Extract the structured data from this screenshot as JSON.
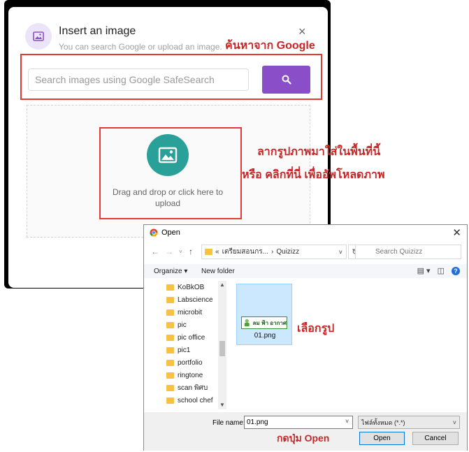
{
  "insert_dialog": {
    "title": "Insert an image",
    "subtitle": "You can search Google or upload an image.",
    "close_glyph": "×",
    "search_placeholder": "Search images using Google SafeSearch",
    "search_value": "",
    "drop_text": "Drag and drop or click here to upload",
    "accent_color": "#8a4fc8",
    "upload_color": "#2aa198"
  },
  "annotations": {
    "google_search": "ค้นหาจาก Google",
    "drag_drop_line1": "ลากรูปภาพมาใส่ในพื้นที่นี้",
    "drag_drop_line2": "หรือ คลิกที่นี่ เพื่ออัพโหลดภาพ",
    "choose_image": "เลือกรูป",
    "press_open": "กดปุ่ม Open",
    "color": "#c62828"
  },
  "open_dialog": {
    "title": "Open",
    "close_glyph": "✕",
    "address_prefix": "«",
    "address_parent": "เตรียมสอนกร...",
    "address_sep": "›",
    "address_current": "Quizizz",
    "search_placeholder": "Search Quizizz",
    "organize_label": "Organize ▾",
    "new_folder_label": "New folder",
    "folders": [
      "KoBkOB",
      "Labscience",
      "microbit",
      "pic",
      "pic office",
      "pic1",
      "portfolio",
      "ringtone",
      "scan พิศบ",
      "school chef"
    ],
    "file": {
      "name": "01.png",
      "thumbnail_text": "ลม ฟ้า อากาศ"
    },
    "file_name_label": "File name:",
    "file_name_value": "01.png",
    "file_type": "ไฟล์ทั้งหมด (*.*)",
    "open_button": "Open",
    "cancel_button": "Cancel"
  }
}
